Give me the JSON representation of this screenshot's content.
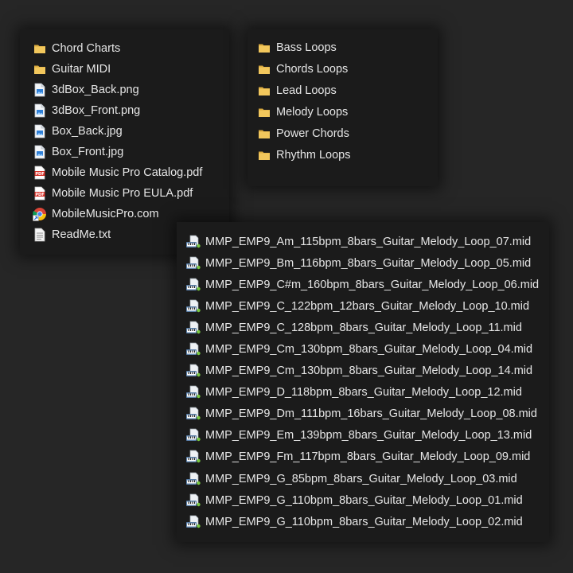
{
  "files_panel": {
    "items": [
      {
        "label": "Chord Charts",
        "icon": "folder-icon"
      },
      {
        "label": "Guitar MIDI",
        "icon": "folder-icon"
      },
      {
        "label": "3dBox_Back.png",
        "icon": "image-file-icon"
      },
      {
        "label": "3dBox_Front.png",
        "icon": "image-file-icon"
      },
      {
        "label": "Box_Back.jpg",
        "icon": "image-file-icon"
      },
      {
        "label": "Box_Front.jpg",
        "icon": "image-file-icon"
      },
      {
        "label": "Mobile Music Pro Catalog.pdf",
        "icon": "pdf-file-icon"
      },
      {
        "label": "Mobile Music Pro EULA.pdf",
        "icon": "pdf-file-icon"
      },
      {
        "label": "MobileMusicPro.com",
        "icon": "chrome-shortcut-icon"
      },
      {
        "label": "ReadMe.txt",
        "icon": "text-file-icon"
      }
    ]
  },
  "folders_panel": {
    "items": [
      {
        "label": "Bass Loops",
        "icon": "folder-icon"
      },
      {
        "label": "Chords Loops",
        "icon": "folder-icon"
      },
      {
        "label": "Lead Loops",
        "icon": "folder-icon"
      },
      {
        "label": "Melody Loops",
        "icon": "folder-icon"
      },
      {
        "label": "Power Chords",
        "icon": "folder-icon"
      },
      {
        "label": "Rhythm Loops",
        "icon": "folder-icon"
      }
    ]
  },
  "midi_panel": {
    "items": [
      {
        "label": "MMP_EMP9_Am_115bpm_8bars_Guitar_Melody_Loop_07.mid",
        "icon": "midi-file-icon"
      },
      {
        "label": "MMP_EMP9_Bm_116bpm_8bars_Guitar_Melody_Loop_05.mid",
        "icon": "midi-file-icon"
      },
      {
        "label": "MMP_EMP9_C#m_160bpm_8bars_Guitar_Melody_Loop_06.mid",
        "icon": "midi-file-icon"
      },
      {
        "label": "MMP_EMP9_C_122bpm_12bars_Guitar_Melody_Loop_10.mid",
        "icon": "midi-file-icon"
      },
      {
        "label": "MMP_EMP9_C_128bpm_8bars_Guitar_Melody_Loop_11.mid",
        "icon": "midi-file-icon"
      },
      {
        "label": "MMP_EMP9_Cm_130bpm_8bars_Guitar_Melody_Loop_04.mid",
        "icon": "midi-file-icon"
      },
      {
        "label": "MMP_EMP9_Cm_130bpm_8bars_Guitar_Melody_Loop_14.mid",
        "icon": "midi-file-icon"
      },
      {
        "label": "MMP_EMP9_D_118bpm_8bars_Guitar_Melody_Loop_12.mid",
        "icon": "midi-file-icon"
      },
      {
        "label": "MMP_EMP9_Dm_111bpm_16bars_Guitar_Melody_Loop_08.mid",
        "icon": "midi-file-icon"
      },
      {
        "label": "MMP_EMP9_Em_139bpm_8bars_Guitar_Melody_Loop_13.mid",
        "icon": "midi-file-icon"
      },
      {
        "label": "MMP_EMP9_Fm_117bpm_8bars_Guitar_Melody_Loop_09.mid",
        "icon": "midi-file-icon"
      },
      {
        "label": "MMP_EMP9_G_85bpm_8bars_Guitar_Melody_Loop_03.mid",
        "icon": "midi-file-icon"
      },
      {
        "label": "MMP_EMP9_G_110bpm_8bars_Guitar_Melody_Loop_01.mid",
        "icon": "midi-file-icon"
      },
      {
        "label": "MMP_EMP9_G_110bpm_8bars_Guitar_Melody_Loop_02.mid",
        "icon": "midi-file-icon"
      }
    ]
  },
  "colors": {
    "background": "#262626",
    "panel": "#1b1b1b",
    "text": "#e6e6e6",
    "folder": "#f2c75c",
    "pdf": "#d9342b"
  }
}
